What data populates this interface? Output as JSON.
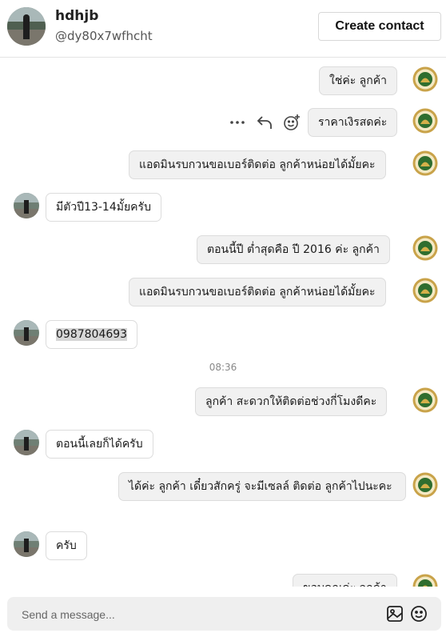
{
  "contact": {
    "name": "hdhjb",
    "handle": "@dy80x7wfhcht"
  },
  "header": {
    "create_contact_label": "Create contact"
  },
  "messages": [
    {
      "dir": "out",
      "text": "ใช่ค่ะ  ลูกค้า"
    },
    {
      "dir": "out",
      "text": "ราคาเงิรสดค่ะ"
    },
    {
      "dir": "out",
      "text": "แอดมินรบกวนขอเบอร์ติดต่อ ลูกค้าหน่อยได้มั้ยคะ"
    },
    {
      "dir": "in",
      "text": "มีตัวปี13-14มั้ยครับ"
    },
    {
      "dir": "out",
      "text": "ตอนนี้ปี ต่ำสุดคือ  ปี 2016 ค่ะ ลูกค้า"
    },
    {
      "dir": "out",
      "text": "แอดมินรบกวนขอเบอร์ติดต่อ ลูกค้าหน่อยได้มั้ยคะ"
    },
    {
      "dir": "in",
      "text": "0987804693"
    },
    {
      "dir": "out",
      "text": "ลูกค้า สะดวกให้ติดต่อช่วงกี่โมงดีคะ"
    },
    {
      "dir": "in",
      "text": "ตอนนี้เลยก็ได้ครับ"
    },
    {
      "dir": "out",
      "text": "ได้ค่ะ ลูกค้า เดี๋ยวสักครู่ จะมีเซลล์ ติดต่อ ลูกค้าไปนะคะ"
    },
    {
      "dir": "in",
      "text": "ครับ"
    },
    {
      "dir": "out",
      "text": "ขอบคุณค่ะ ลูกค้า"
    }
  ],
  "timestamp": "08:36",
  "composer": {
    "placeholder": "Send a message..."
  },
  "icons": [
    "more-icon",
    "reply-icon",
    "add-reaction-icon",
    "image-icon",
    "emoji-icon"
  ]
}
